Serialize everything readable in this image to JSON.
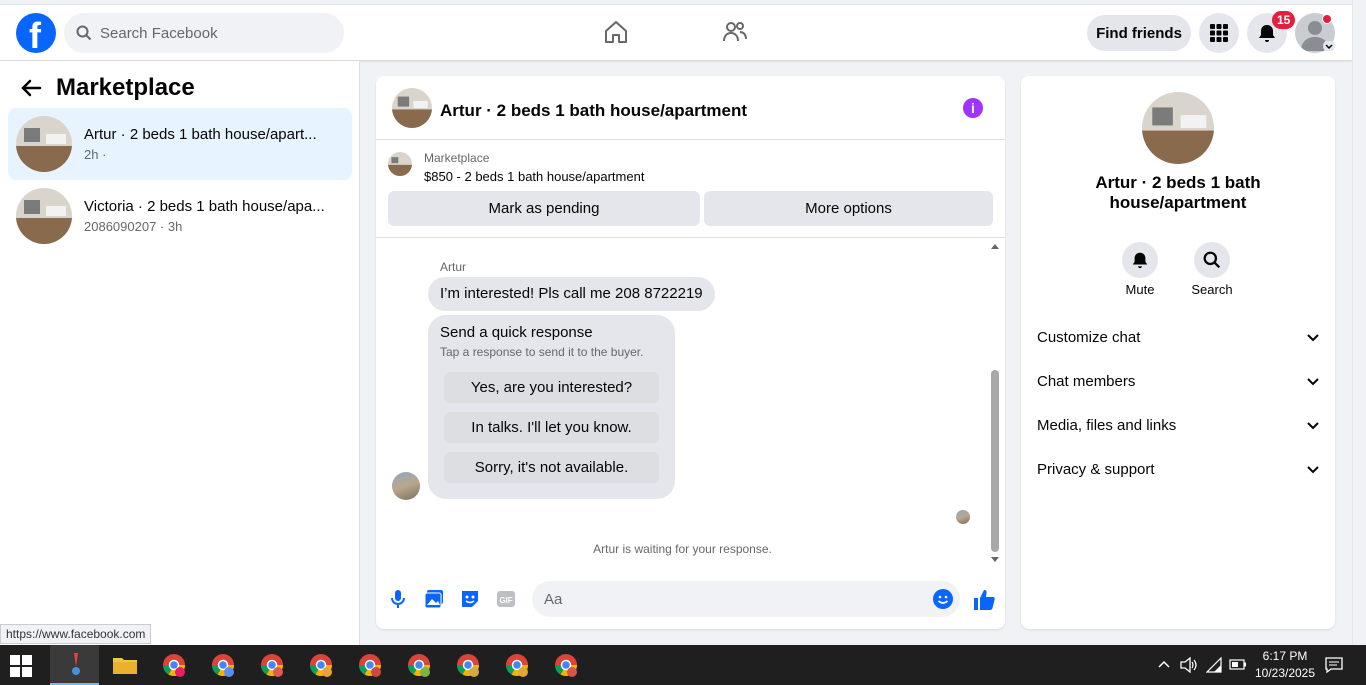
{
  "topbar": {
    "search_placeholder": "Search Facebook",
    "find_friends": "Find friends",
    "notification_count": "15",
    "brand_color": "#0866ff"
  },
  "sidebar": {
    "title": "Marketplace",
    "conversations": [
      {
        "title": "Artur · 2 beds 1 bath house/apart...",
        "meta": "2h ·",
        "active": true
      },
      {
        "title": "Victoria · 2 beds 1 bath house/apa...",
        "meta": "2086090207 · 3h",
        "active": false
      }
    ]
  },
  "status_url": "https://www.facebook.com",
  "chat": {
    "header_title": "Artur · 2 beds 1 bath house/apartment",
    "listing_source": "Marketplace",
    "listing_price": "$850 - 2 beds 1 bath house/apartment",
    "mark_pending": "Mark as pending",
    "more_options": "More options",
    "sender_name": "Artur",
    "message": "I’m interested!  Pls call me 208 8722219",
    "quick_title": "Send a quick response",
    "quick_subtitle": "Tap a response to send it to the buyer.",
    "quick_responses": [
      "Yes, are you interested?",
      "In talks. I'll let you know.",
      "Sorry, it's not available."
    ],
    "waiting_text": "Artur is waiting for your response.",
    "composer_placeholder": "Aa"
  },
  "details": {
    "name": "Artur · 2 beds 1 bath house/apartment",
    "mute_label": "Mute",
    "search_label": "Search",
    "sections": [
      "Customize chat",
      "Chat members",
      "Media, files and links",
      "Privacy & support"
    ]
  },
  "taskbar": {
    "time": "6:17 PM",
    "date": "10/23/2025"
  }
}
